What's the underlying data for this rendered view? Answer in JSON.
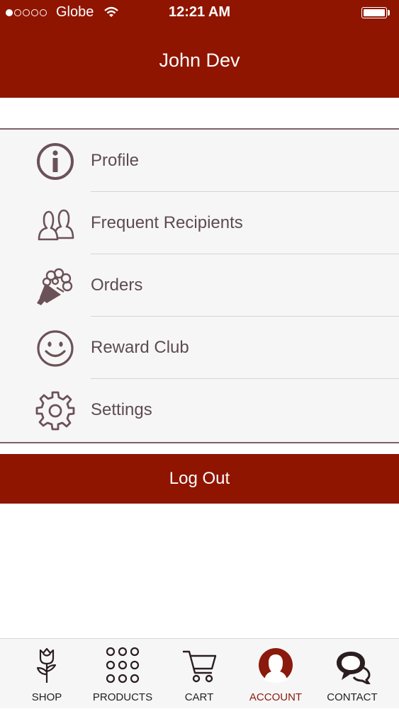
{
  "status_bar": {
    "signal_dots": 5,
    "signal_filled": 1,
    "carrier": "Globe",
    "time": "12:21 AM"
  },
  "header": {
    "title": "John Dev"
  },
  "menu": {
    "items": [
      {
        "label": "Profile",
        "icon": "info-icon"
      },
      {
        "label": "Frequent Recipients",
        "icon": "people-icon"
      },
      {
        "label": "Orders",
        "icon": "bouquet-icon"
      },
      {
        "label": "Reward Club",
        "icon": "smiley-icon"
      },
      {
        "label": "Settings",
        "icon": "gear-icon"
      }
    ]
  },
  "logout": {
    "label": "Log Out"
  },
  "tabbar": {
    "tabs": [
      {
        "label": "SHOP",
        "icon": "rose-icon",
        "active": false
      },
      {
        "label": "PRODUCTS",
        "icon": "grid-dots-icon",
        "active": false
      },
      {
        "label": "CART",
        "icon": "cart-icon",
        "active": false
      },
      {
        "label": "ACCOUNT",
        "icon": "account-icon",
        "active": true
      },
      {
        "label": "CONTACT",
        "icon": "chat-bubbles-icon",
        "active": false
      }
    ]
  },
  "colors": {
    "brand": "#8f1500",
    "icon": "#6b5258",
    "text": "#5c4b52",
    "active_tab": "#8a1a0b"
  }
}
